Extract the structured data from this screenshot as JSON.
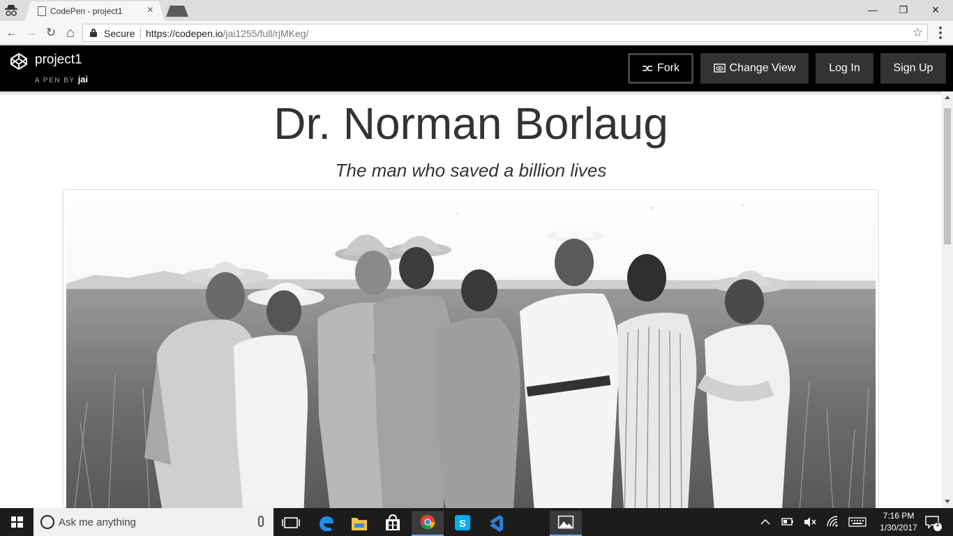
{
  "browser": {
    "tab_title": "CodePen - project1",
    "tab_close": "×",
    "secure_label": "Secure",
    "url_host": "https://codepen.io",
    "url_path": "/jai1255/full/rjMKeg/",
    "window_controls": {
      "minimize": "—",
      "restore": "❐",
      "close": "✕"
    },
    "nav": {
      "back": "←",
      "forward": "→",
      "reload": "↻",
      "home": "⌂",
      "star": "☆"
    }
  },
  "codepen": {
    "project_title": "project1",
    "by_prefix": "A PEN BY",
    "author": "jai",
    "buttons": {
      "fork": "Fork",
      "change_view": "Change View",
      "log_in": "Log In",
      "sign_up": "Sign Up"
    }
  },
  "page": {
    "heading": "Dr. Norman Borlaug",
    "subheading": "The man who saved a billion lives",
    "image_subject": "group-photo-wheat-field"
  },
  "taskbar": {
    "search_placeholder": "Ask me anything",
    "time": "7:16 PM",
    "date": "1/30/2017",
    "notification_count": "1"
  },
  "colors": {
    "codepen_header": "#000000",
    "button_bg": "#333333",
    "heading_text": "#333333",
    "taskbar": "#1c1c1c"
  }
}
